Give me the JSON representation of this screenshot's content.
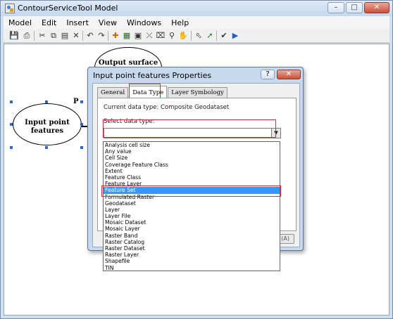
{
  "window": {
    "title": "ContourServiceTool Model",
    "controls": {
      "minimize": "–",
      "maximize": "□",
      "close": "✕"
    }
  },
  "menu": [
    "Model",
    "Edit",
    "Insert",
    "View",
    "Windows",
    "Help"
  ],
  "toolbar": {
    "icons": [
      "save-icon",
      "print-icon",
      "cut-icon",
      "copy-icon",
      "paste-icon",
      "delete-icon",
      "undo-icon",
      "redo-icon",
      "add-data-icon",
      "grid-layout-icon",
      "full-extent-icon",
      "zoom-in-icon",
      "zoom-out-icon",
      "pan-icon",
      "select-icon",
      "connect-icon",
      "validate-icon",
      "run-icon"
    ]
  },
  "model": {
    "output_node": "Output surface",
    "input_node": "Input point features",
    "parameter_marker": "P"
  },
  "dialog": {
    "title": "Input point features Properties",
    "help": "?",
    "close": "✕",
    "tabs": [
      {
        "label": "General",
        "active": false
      },
      {
        "label": "Data Type",
        "active": true
      },
      {
        "label": "Layer Symbology",
        "active": false
      }
    ],
    "current_type_label": "Current data type: Composite Geodataset",
    "select_label": "Select data type:",
    "combo_value": "",
    "bottom_button_tail": "(A)"
  },
  "dropdown": {
    "selected_index": 7,
    "items": [
      "Analysis cell size",
      "Any value",
      "Cell Size",
      "Coverage Feature Class",
      "Extent",
      "Feature Class",
      "Feature Layer",
      "Feature Set",
      "Formulated Raster",
      "Geodataset",
      "Layer",
      "Layer File",
      "Mosaic Dataset",
      "Mosaic Layer",
      "Raster Band",
      "Raster Catalog",
      "Raster Dataset",
      "Raster Layer",
      "Shapefile",
      "TIN"
    ]
  },
  "colors": {
    "highlight_outline": "#e0282a",
    "selection": "#3399ff",
    "window_frame": "#cfe0f1"
  }
}
